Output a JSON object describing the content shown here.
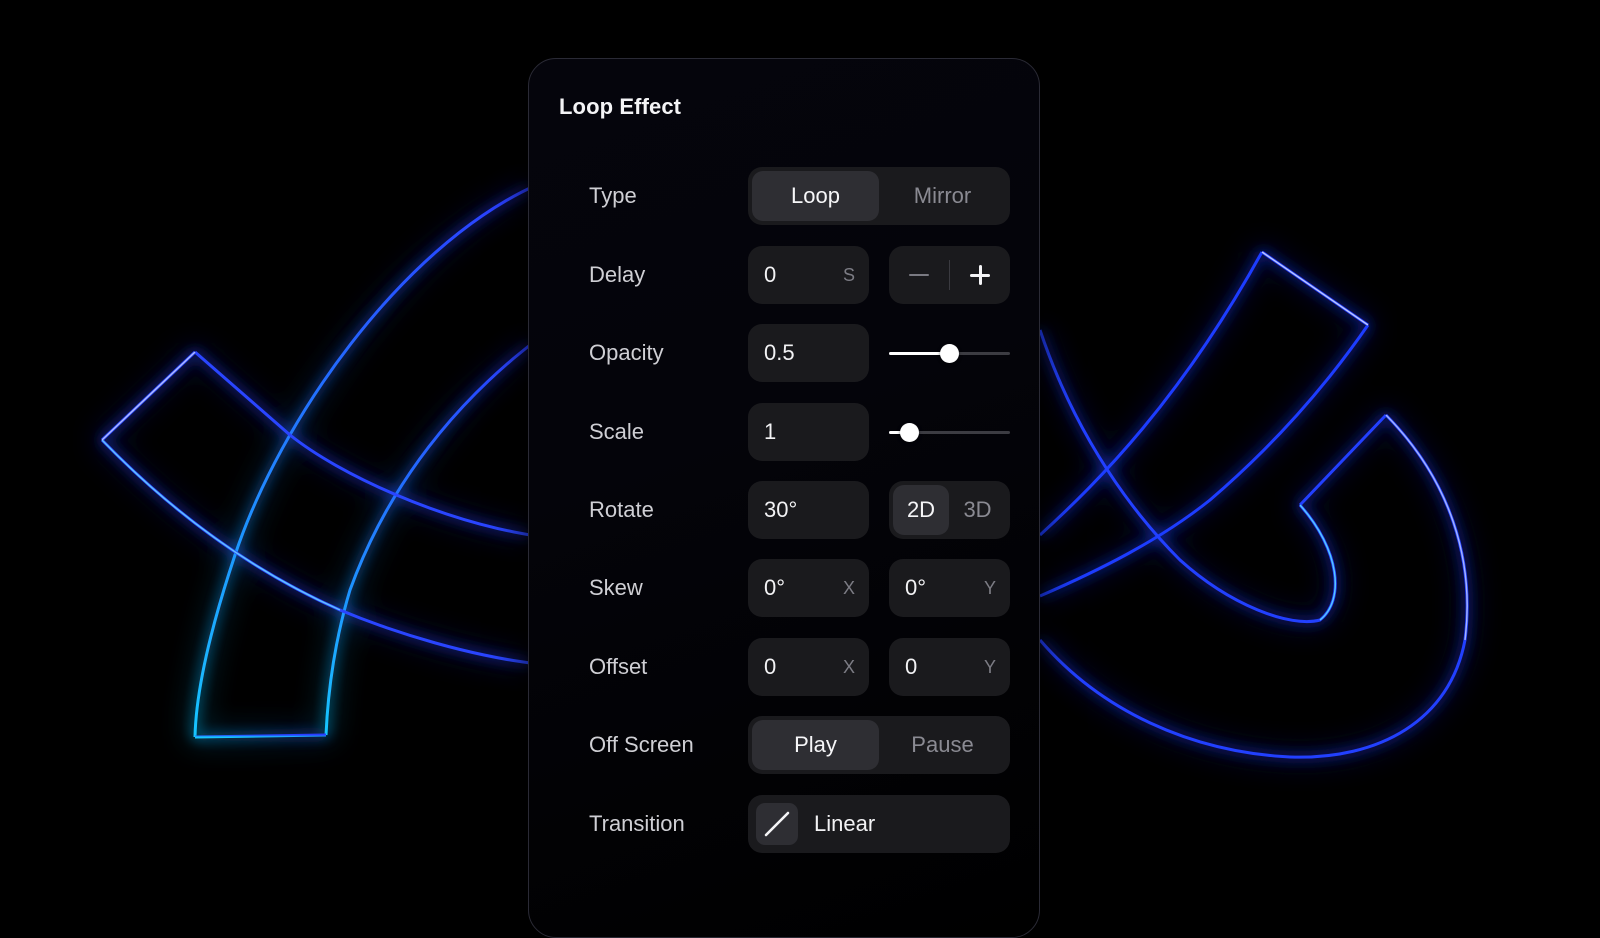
{
  "panel": {
    "title": "Loop Effect"
  },
  "rows": {
    "type": {
      "label": "Type",
      "options": [
        "Loop",
        "Mirror"
      ],
      "selected": "Loop"
    },
    "delay": {
      "label": "Delay",
      "value": "0",
      "unit": "S",
      "decrement_icon": "minus-icon",
      "increment_icon": "plus-icon"
    },
    "opacity": {
      "label": "Opacity",
      "value": "0.5",
      "slider_fraction": 0.5
    },
    "scale": {
      "label": "Scale",
      "value": "1",
      "slider_fraction": 0.17
    },
    "rotate": {
      "label": "Rotate",
      "value": "30°",
      "options": [
        "2D",
        "3D"
      ],
      "selected": "2D"
    },
    "skew": {
      "label": "Skew",
      "x_value": "0°",
      "x_unit": "X",
      "y_value": "0°",
      "y_unit": "Y"
    },
    "offset": {
      "label": "Offset",
      "x_value": "0",
      "x_unit": "X",
      "y_value": "0",
      "y_unit": "Y"
    },
    "off_screen": {
      "label": "Off Screen",
      "options": [
        "Play",
        "Pause"
      ],
      "selected": "Play"
    },
    "transition": {
      "label": "Transition",
      "value": "Linear",
      "icon": "linear-curve-icon"
    }
  },
  "colors": {
    "background": "#000000",
    "neon_primary": "#1a2cff",
    "neon_highlight": "#19c8ff",
    "control_bg": "#1a1a1d",
    "segment_active": "#2e2e33"
  }
}
